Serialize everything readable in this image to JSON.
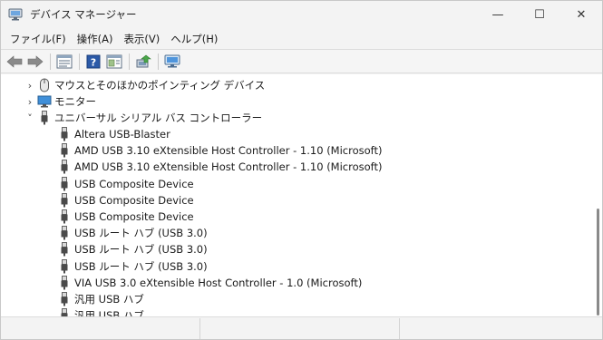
{
  "window": {
    "title": "デバイス マネージャー",
    "controls": {
      "minimize": "—",
      "maximize": "☐",
      "close": "✕"
    }
  },
  "menu": [
    {
      "label": "ファイル(F)"
    },
    {
      "label": "操作(A)"
    },
    {
      "label": "表示(V)"
    },
    {
      "label": "ヘルプ(H)"
    }
  ],
  "tree": {
    "categories": [
      {
        "label": "マウスとそのほかのポインティング デバイス",
        "expander": "›",
        "icon": "mouse-icon"
      },
      {
        "label": "モニター",
        "expander": "›",
        "icon": "monitor-icon"
      },
      {
        "label": "ユニバーサル シリアル バス コントローラー",
        "expander": "˅",
        "icon": "usb-icon"
      }
    ],
    "usb_devices": [
      "Altera USB-Blaster",
      "AMD USB 3.10 eXtensible Host Controller - 1.10 (Microsoft)",
      "AMD USB 3.10 eXtensible Host Controller - 1.10 (Microsoft)",
      "USB Composite Device",
      "USB Composite Device",
      "USB Composite Device",
      "USB ルート ハブ (USB 3.0)",
      "USB ルート ハブ (USB 3.0)",
      "USB ルート ハブ (USB 3.0)",
      "VIA USB 3.0 eXtensible Host Controller - 1.0 (Microsoft)",
      "汎用 USB ハブ",
      "汎用 USB ハブ"
    ]
  },
  "colors": {
    "accent": "#2b6cc4",
    "arrow_gray": "#7a7a7a"
  }
}
